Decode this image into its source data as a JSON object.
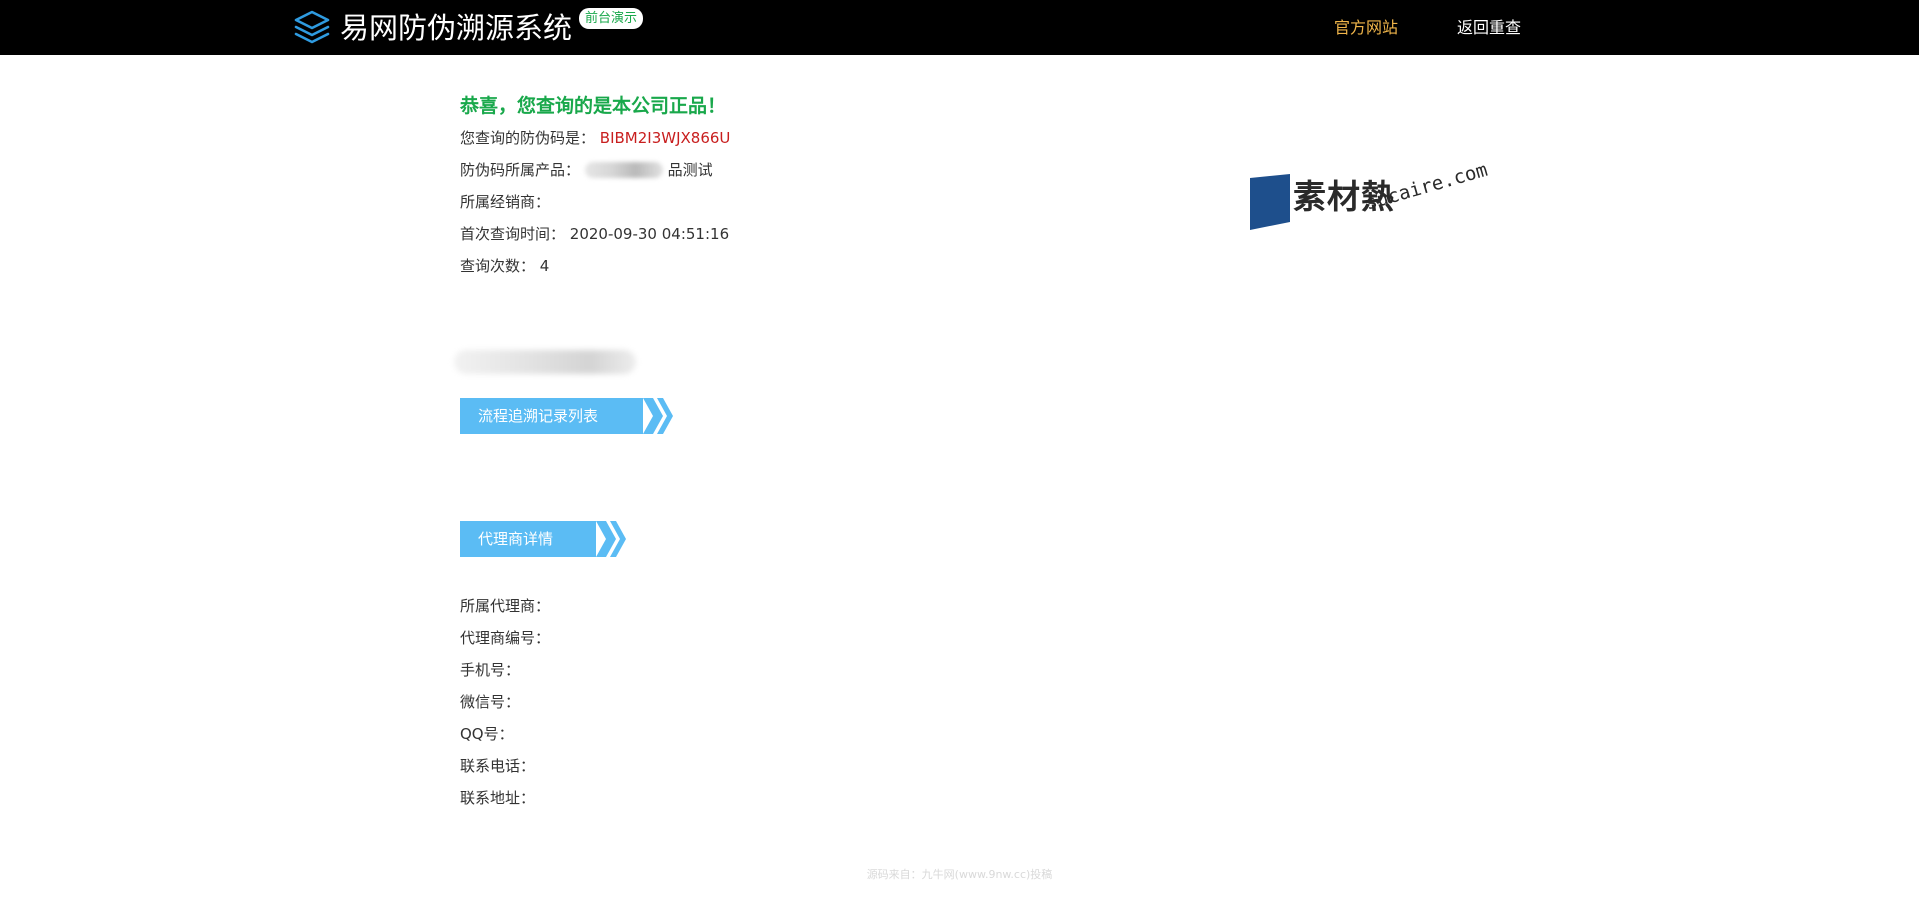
{
  "header": {
    "brand_title": "易网防伪溯源系统",
    "demo_badge": "前台演示",
    "nav_official": "官方网站",
    "nav_back": "返回重查"
  },
  "result": {
    "success_title": "恭喜，您查询的是本公司正品！",
    "code_label": "您查询的防伪码是：",
    "code_value": "BIBM2I3WJX866U",
    "product_label": "防伪码所属产品：",
    "product_value_visible": "品测试",
    "distributor_label": "所属经销商：",
    "distributor_value": "",
    "first_query_label": "首次查询时间：",
    "first_query_value": "2020-09-30 04:51:16",
    "query_count_label": "查询次数：",
    "query_count_value": "4"
  },
  "sections": {
    "trace_title": "流程追溯记录列表",
    "agent_title": "代理商详情"
  },
  "agent": {
    "rows": [
      {
        "label": "所属代理商：",
        "value": ""
      },
      {
        "label": "代理商编号：",
        "value": ""
      },
      {
        "label": "手机号：",
        "value": ""
      },
      {
        "label": "微信号：",
        "value": ""
      },
      {
        "label": "QQ号：",
        "value": ""
      },
      {
        "label": "联系电话：",
        "value": ""
      },
      {
        "label": "联系地址：",
        "value": ""
      }
    ]
  },
  "watermark": {
    "text": "素材熱",
    "url": "sucaire.com"
  },
  "footer": {
    "text": "源码来自：九牛网(www.9nw.cc)投稿"
  },
  "colors": {
    "header_bg": "#000000",
    "success_green": "#19a84b",
    "code_red": "#c81e1e",
    "nav_official": "#f0b54a",
    "banner_blue": "#5bbcf4",
    "brand_icon_blue": "#2f9be0"
  },
  "icons": {
    "brand": "layers-icon",
    "banner_arrow": "double-chevron-right-icon"
  }
}
